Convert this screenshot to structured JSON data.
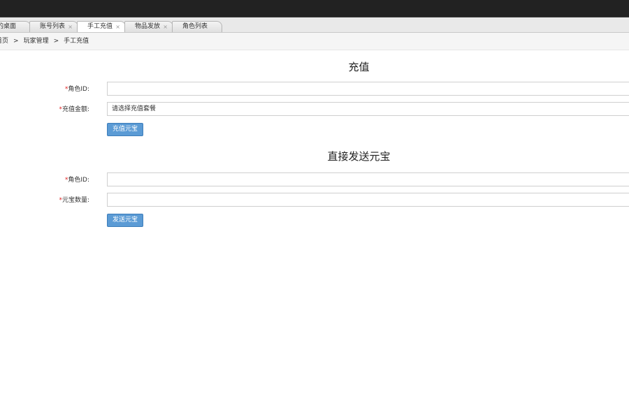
{
  "tabs": [
    {
      "label": "我的桌面",
      "closable": false
    },
    {
      "label": "账号列表",
      "closable": true
    },
    {
      "label": "手工充值",
      "closable": true,
      "active": true
    },
    {
      "label": "物品发放",
      "closable": true
    },
    {
      "label": "角色列表",
      "closable": false
    }
  ],
  "tab_close_glyph": "×",
  "breadcrumb": {
    "items": [
      "首页",
      "玩家管理",
      "手工充值"
    ],
    "separator": ">"
  },
  "recharge": {
    "title": "充值",
    "role_label": "角色ID:",
    "amount_label": "充值金额:",
    "amount_value": "请选择充值套餐",
    "submit_label": "充值元宝"
  },
  "direct_send": {
    "title": "直接发送元宝",
    "role_label": "角色ID:",
    "count_label": "元宝数量:",
    "submit_label": "发送元宝"
  },
  "required_mark": "*",
  "colors": {
    "topbar": "#222222",
    "button": "#5b9bd5",
    "required": "#e02222"
  }
}
